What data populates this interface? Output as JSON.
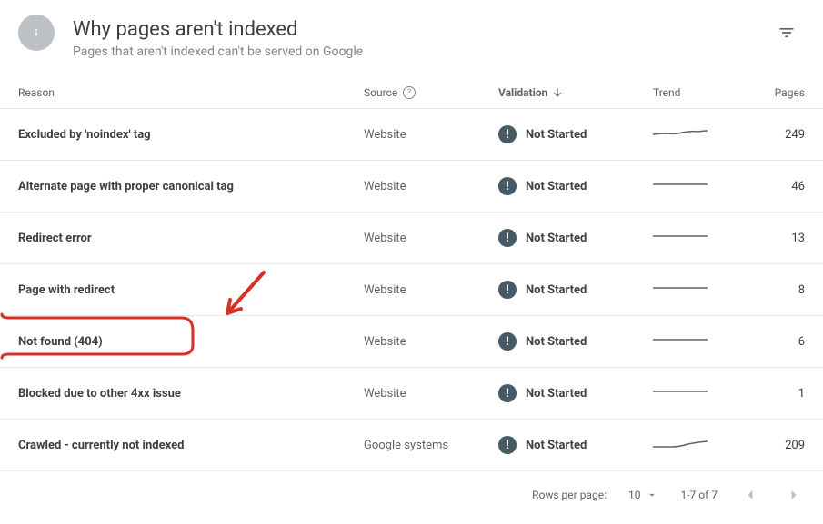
{
  "header": {
    "title": "Why pages aren't indexed",
    "subtitle": "Pages that aren't indexed can't be served on Google"
  },
  "columns": {
    "reason": "Reason",
    "source": "Source",
    "validation": "Validation",
    "trend": "Trend",
    "pages": "Pages"
  },
  "validation_label": "Not Started",
  "rows": [
    {
      "reason": "Excluded by 'noindex' tag",
      "source": "Website",
      "pages": "249",
      "trend": "wavy"
    },
    {
      "reason": "Alternate page with proper canonical tag",
      "source": "Website",
      "pages": "46",
      "trend": "flat"
    },
    {
      "reason": "Redirect error",
      "source": "Website",
      "pages": "13",
      "trend": "flat"
    },
    {
      "reason": "Page with redirect",
      "source": "Website",
      "pages": "8",
      "trend": "flat"
    },
    {
      "reason": "Not found (404)",
      "source": "Website",
      "pages": "6",
      "trend": "flat"
    },
    {
      "reason": "Blocked due to other 4xx issue",
      "source": "Website",
      "pages": "1",
      "trend": "flat"
    },
    {
      "reason": "Crawled - currently not indexed",
      "source": "Google systems",
      "pages": "209",
      "trend": "rise"
    }
  ],
  "pager": {
    "rows_label": "Rows per page:",
    "rows_value": "10",
    "range": "1-7 of 7"
  },
  "annotation": {
    "highlighted_row_index": 4
  }
}
